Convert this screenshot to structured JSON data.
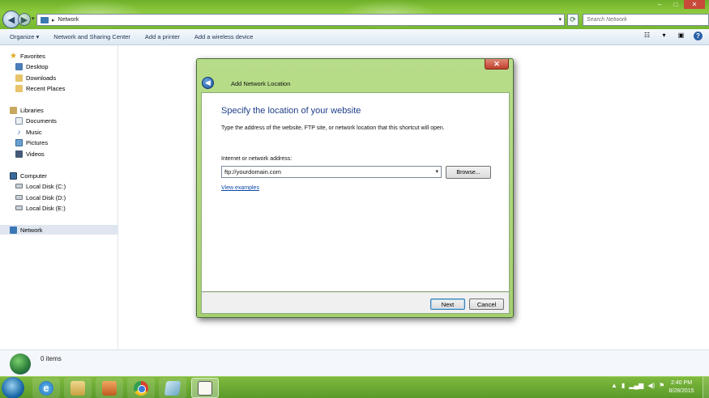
{
  "explorer": {
    "address": {
      "location": "Network"
    },
    "search": {
      "placeholder": "Search Network"
    },
    "toolbar": {
      "organize": "Organize ▾",
      "network_sharing_center": "Network and Sharing Center",
      "add_printer": "Add a printer",
      "add_wireless": "Add a wireless device"
    },
    "sidebar": {
      "favorites": "Favorites",
      "desktop": "Desktop",
      "downloads": "Downloads",
      "recent_places": "Recent Places",
      "libraries": "Libraries",
      "documents": "Documents",
      "music": "Music",
      "pictures": "Pictures",
      "videos": "Videos",
      "computer": "Computer",
      "local_disk_c": "Local Disk (C:)",
      "local_disk_d": "Local Disk (D:)",
      "local_disk_e": "Local Disk (E:)",
      "network": "Network"
    },
    "status": {
      "items": "0 items"
    }
  },
  "dialog": {
    "title": "Add Network Location",
    "heading": "Specify the location of your website",
    "description": "Type the address of the website, FTP site, or network location that this shortcut will open.",
    "address_label": "Internet or network address:",
    "address_value": "ftp://yourdomain.com",
    "browse": "Browse...",
    "view_examples": "View examples",
    "next": "Next",
    "cancel": "Cancel",
    "close_glyph": "✕"
  },
  "taskbar": {
    "clock_time": "2:40 PM",
    "clock_date": "8/28/2015"
  },
  "colors": {
    "accent_green": "#7fba3e",
    "heading_blue": "#1e3f8a",
    "link_blue": "#0a4aa8"
  },
  "icons": [
    "back-arrow-icon",
    "forward-arrow-icon",
    "network-icon",
    "refresh-icon",
    "star-icon",
    "folder-icon",
    "computer-icon",
    "disk-icon",
    "help-icon",
    "close-icon",
    "internet-explorer-icon",
    "chrome-icon",
    "media-player-icon"
  ]
}
